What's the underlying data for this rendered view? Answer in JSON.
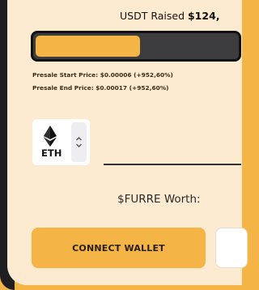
{
  "presale": {
    "raised_label": "USDT Raised",
    "raised_amount": "$124,",
    "progress_fraction": 0.52,
    "start_price_text": "Presale Start Price: $0.00006 (+952,60%)",
    "end_price_text": "Presale End Price: $0.00017 (+952,60%)"
  },
  "currency": {
    "selected": "ETH",
    "icon": "ethereum-icon"
  },
  "worth_label": "$FURRE Worth:",
  "buttons": {
    "connect_wallet": "CONNECT WALLET"
  },
  "colors": {
    "accent": "#f4b446",
    "card": "#fcebd0",
    "dark": "#1f1f22"
  }
}
